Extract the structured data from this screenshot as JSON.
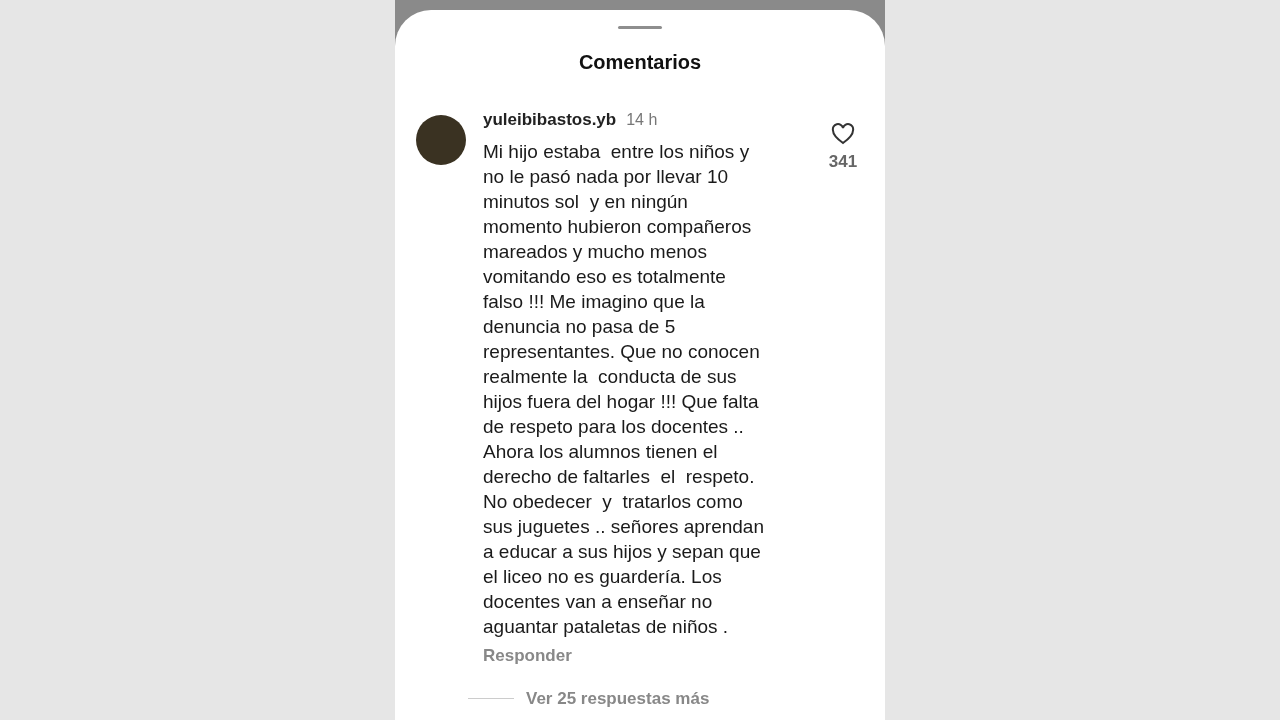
{
  "sheet": {
    "title": "Comentarios"
  },
  "comment": {
    "username": "yuleibibastos.yb",
    "time": "14 h",
    "lines": [
      "Mi hijo estaba  entre los niños y",
      "no le pasó nada por llevar 10",
      "minutos sol  y en ningún",
      "momento hubieron compañeros",
      "mareados y mucho menos",
      "vomitando eso es totalmente",
      "falso !!! Me imagino que la",
      "denuncia no pasa de 5",
      "representantes. Que no conocen",
      "realmente la  conducta de sus",
      "hijos fuera del hogar !!! Que falta",
      "de respeto para los docentes ..",
      "Ahora los alumnos tienen el",
      "derecho de faltarles  el  respeto.",
      "No obedecer  y  tratarlos como",
      "sus juguetes .. señores aprendan",
      "a educar a sus hijos y sepan que",
      "el liceo no es guardería. Los",
      "docentes van a enseñar no",
      "aguantar pataletas de niños ."
    ],
    "likes": "341",
    "reply": "Responder",
    "more_replies": "Ver 25 respuestas más"
  }
}
